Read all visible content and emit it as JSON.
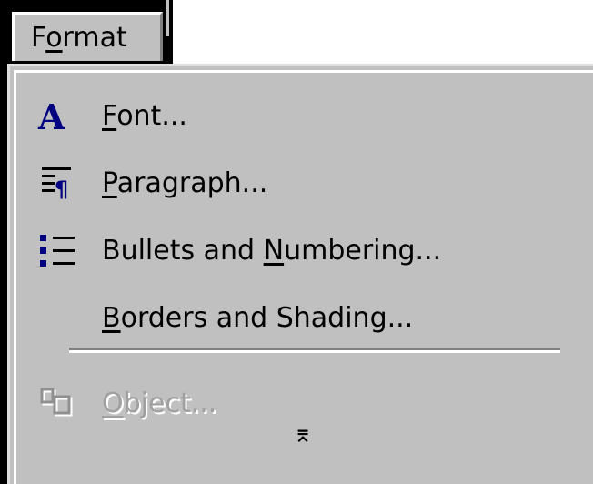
{
  "menubar": {
    "menu_title_prefix": "F",
    "menu_title_mnemonic": "o",
    "menu_title_suffix": "rmat"
  },
  "menu": {
    "items": [
      {
        "mnemonic": "F",
        "rest": "ont...",
        "icon": "font-icon",
        "enabled": true
      },
      {
        "mnemonic": "P",
        "rest": "aragraph...",
        "icon": "paragraph-icon",
        "enabled": true
      },
      {
        "prefix": "Bullets and ",
        "mnemonic": "N",
        "rest": "umbering...",
        "icon": "bullets-numbering-icon",
        "enabled": true
      },
      {
        "mnemonic": "B",
        "rest": "orders and Shading...",
        "icon": "",
        "enabled": true
      },
      {
        "mnemonic": "O",
        "rest": "bject...",
        "icon": "object-icon",
        "enabled": false
      }
    ],
    "expand_glyph": "⌆",
    "expand_icon": "chevron-double-down-icon"
  },
  "colors": {
    "menu_background": "#c0c0c0",
    "icon_blue": "#000080",
    "disabled_text": "#a0a0a0"
  }
}
